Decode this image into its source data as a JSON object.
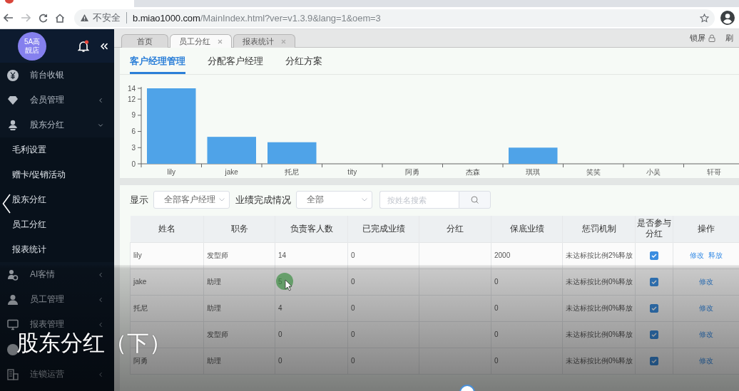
{
  "browser": {
    "security_label": "不安全",
    "url_host": "b.miao1000.com",
    "url_path": "/MainIndex.html?ver=v1.3.9&lang=1&oem=3"
  },
  "sidebar": {
    "logo_lines": [
      "5A高",
      "靓店"
    ],
    "items": [
      {
        "kind": "link",
        "label": "前台收银"
      },
      {
        "kind": "group",
        "label": "会员管理",
        "expanded": false
      },
      {
        "kind": "group",
        "label": "股东分红",
        "expanded": true,
        "children": [
          "毛利设置",
          "赠卡/促销活动",
          "股东分红",
          "员工分红",
          "报表统计"
        ]
      },
      {
        "kind": "group",
        "label": "AI客情",
        "expanded": false
      },
      {
        "kind": "group",
        "label": "员工管理",
        "expanded": false
      },
      {
        "kind": "group",
        "label": "报表管理",
        "expanded": false
      },
      {
        "kind": "link"
      },
      {
        "kind": "group",
        "label": "连锁运营",
        "expanded": false
      }
    ]
  },
  "page_tabs": [
    {
      "label": "首页",
      "selected": false,
      "closable": false
    },
    {
      "label": "员工分红",
      "selected": true,
      "closable": true
    },
    {
      "label": "报表统计",
      "selected": false,
      "closable": true
    }
  ],
  "tab_tools": [
    {
      "kind": "lock",
      "label": "锁屏"
    },
    {
      "kind": "refresh",
      "label": "刷"
    }
  ],
  "sub_tabs": [
    {
      "label": "客户经理管理",
      "selected": true
    },
    {
      "label": "分配客户经理",
      "selected": false
    },
    {
      "label": "分红方案",
      "selected": false
    }
  ],
  "chart": {
    "chart_data": {
      "type": "bar",
      "categories": [
        "lily",
        "jake",
        "托尼",
        "tity",
        "阿勇",
        "杰森",
        "琪琪",
        "笑笑",
        "小吴",
        "轩哥"
      ],
      "values": [
        14,
        5,
        4,
        0,
        0,
        0,
        3,
        0,
        0,
        0
      ],
      "ylim": [
        0,
        14
      ],
      "yticks": [
        0,
        3,
        6,
        9,
        12,
        14
      ]
    }
  },
  "filters": {
    "selects": [
      {
        "label": "显示",
        "value": "全部客户经理"
      },
      {
        "label": "业绩完成情况",
        "value": "全部"
      }
    ],
    "search": {
      "placeholder": "按姓名搜索"
    }
  },
  "table": {
    "columns": [
      "姓名",
      "职务",
      "负责客人数",
      "已完成业绩",
      "分红",
      "保底业绩",
      "惩罚机制",
      "是否参与分红",
      "操作"
    ],
    "rows": [
      {
        "name": "lily",
        "role": "发型师",
        "clients": "14",
        "completed": "0",
        "guarantee": "2000",
        "penalty": "未达标按比例2%释放",
        "in_dividend": true,
        "actions": [
          "修改",
          "释放"
        ]
      },
      {
        "name": "jake",
        "role": "助理",
        "clients": "5",
        "completed": "0",
        "guarantee": "0",
        "penalty": "未达标按比例0%释放",
        "in_dividend": true,
        "actions": [
          "修改"
        ]
      },
      {
        "name": "托尼",
        "role": "助理",
        "clients": "4",
        "completed": "0",
        "guarantee": "0",
        "penalty": "未达标按比例0%释放",
        "in_dividend": true,
        "actions": [
          "修改"
        ]
      },
      {
        "role": "发型师",
        "clients": "0",
        "completed": "0",
        "guarantee": "0",
        "penalty": "未达标按比例0%释放",
        "in_dividend": true,
        "actions": [
          "修改"
        ]
      },
      {
        "name": "阿勇",
        "role": "助理",
        "clients": "0",
        "completed": "0",
        "guarantee": "0",
        "penalty": "未达标按比例0%释放",
        "in_dividend": true,
        "actions": [
          "修改"
        ]
      }
    ]
  },
  "caption": "股东分红（下）"
}
